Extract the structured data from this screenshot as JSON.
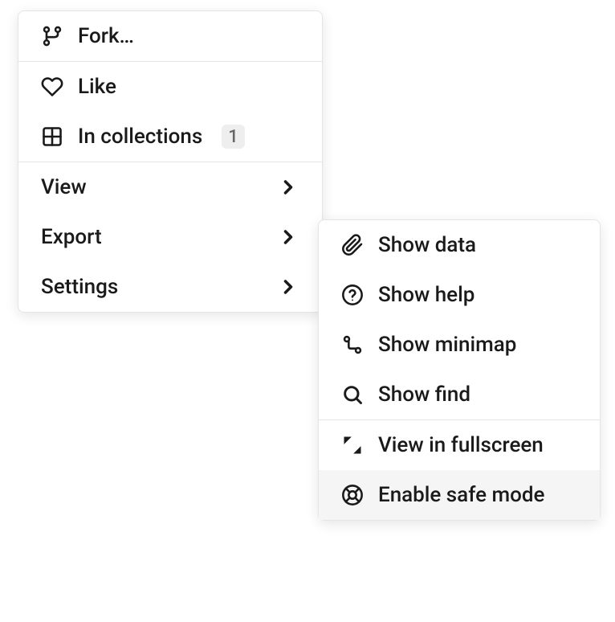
{
  "primaryMenu": {
    "fork": "Fork…",
    "like": "Like",
    "collections": "In collections",
    "collectionsCount": "1",
    "view": "View",
    "export": "Export",
    "settings": "Settings"
  },
  "secondaryMenu": {
    "showData": "Show data",
    "showHelp": "Show help",
    "showMinimap": "Show minimap",
    "showFind": "Show find",
    "fullscreen": "View in fullscreen",
    "safeMode": "Enable safe mode"
  }
}
